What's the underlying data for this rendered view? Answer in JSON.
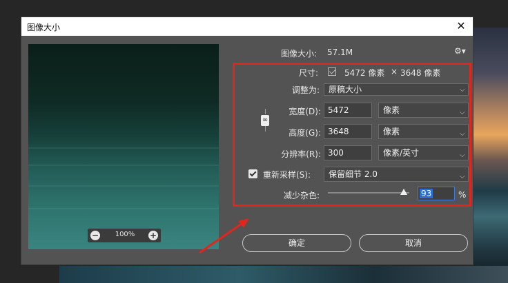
{
  "dialog": {
    "title": "图像大小",
    "close_glyph": "✕",
    "image_size_label": "图像大小:",
    "image_size_value": "57.1M",
    "settings_glyph": "⚙▾"
  },
  "preview": {
    "zoom_out_glyph": "−",
    "zoom_in_glyph": "+",
    "zoom_level": "100%"
  },
  "dimensions": {
    "label": "尺寸:",
    "width_value": "5472 像素",
    "times": "×",
    "height_value": "3648 像素"
  },
  "fit": {
    "label": "调整为:",
    "value": "原稿大小"
  },
  "width": {
    "label": "宽度(D):",
    "value": "5472",
    "unit": "像素"
  },
  "height": {
    "label": "高度(G):",
    "value": "3648",
    "unit": "像素"
  },
  "resolution": {
    "label": "分辨率(R):",
    "value": "300",
    "unit": "像素/英寸"
  },
  "resample": {
    "checked": true,
    "label": "重新采样(S):",
    "value": "保留细节 2.0"
  },
  "noise": {
    "label": "减少杂色:",
    "value": "93",
    "percent_sign": "%",
    "level_percent": 93
  },
  "buttons": {
    "ok": "确定",
    "cancel": "取消"
  },
  "colors": {
    "highlight_box": "#e0261d",
    "arrow": "#e0261d",
    "selection": "#2a6fd6"
  },
  "icons": {
    "link": "chain-link-icon",
    "settings": "gear-icon",
    "close": "close-icon"
  }
}
